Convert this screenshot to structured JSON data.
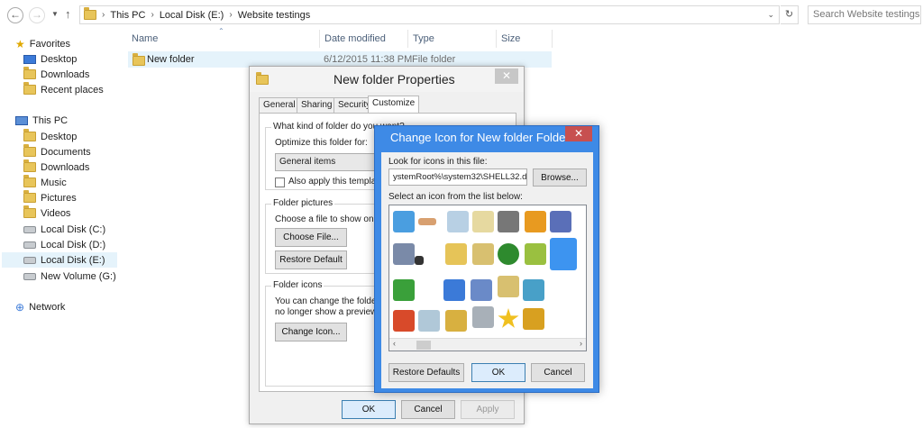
{
  "address": {
    "back_icon": "back-arrow-icon",
    "crumbs": [
      "This PC",
      "Local Disk (E:)",
      "Website testings"
    ],
    "search_placeholder": "Search Website testings"
  },
  "sidebar": {
    "favorites": {
      "label": "Favorites",
      "items": [
        "Desktop",
        "Downloads",
        "Recent places"
      ]
    },
    "thispc": {
      "label": "This PC",
      "items": [
        "Desktop",
        "Documents",
        "Downloads",
        "Music",
        "Pictures",
        "Videos",
        "Local Disk (C:)",
        "Local Disk (D:)",
        "Local Disk (E:)",
        "New Volume (G:)"
      ]
    },
    "network": {
      "label": "Network"
    }
  },
  "filelist": {
    "columns": [
      "Name",
      "Date modified",
      "Type",
      "Size"
    ],
    "rows": [
      {
        "name": "New folder",
        "date": "6/12/2015 11:38 PM",
        "type": "File folder",
        "size": ""
      }
    ]
  },
  "properties": {
    "title": "New folder Properties",
    "tabs": [
      "General",
      "Sharing",
      "Security",
      "Customize"
    ],
    "kind_question": "What kind of folder do you want?",
    "optimize_label": "Optimize this folder for:",
    "optimize_value": "General items",
    "also_apply": "Also apply this template t",
    "pictures_group": "Folder pictures",
    "pictures_text": "Choose a file to show on this",
    "choose_file": "Choose File...",
    "restore_default": "Restore Default",
    "icons_group": "Folder icons",
    "icons_text1": "You can change the folder ic",
    "icons_text2": "no longer show a preview of",
    "change_icon": "Change Icon...",
    "ok": "OK",
    "cancel": "Cancel",
    "apply": "Apply"
  },
  "change_icon": {
    "title": "Change Icon for New folder Folder",
    "look_label": "Look for icons in this file:",
    "path": "ystemRoot%\\system32\\SHELL32.dll",
    "browse": "Browse...",
    "select_label": "Select an icon from the list below:",
    "restore_defaults": "Restore Defaults",
    "ok": "OK",
    "cancel": "Cancel"
  },
  "colors": {
    "accent": "#3e8ae6",
    "close_red": "#c75050",
    "selection": "#e5f3fb"
  }
}
